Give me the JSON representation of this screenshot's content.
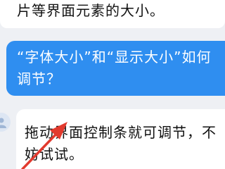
{
  "messages": {
    "previous": "片等界面元素的大小。",
    "question": "“字体大小”和“显示大小”如何调节？",
    "answer": "拖动界面控制条就可调节，不妨试试。"
  },
  "icons": {
    "avatar": "assistant-avatar-icon",
    "pointer": "red-pointer-arrow"
  },
  "colors": {
    "background": "#eef0f4",
    "question_bubble": "#2f8ef0",
    "answer_bubble": "#ffffff",
    "arrow": "#e23a2e"
  }
}
